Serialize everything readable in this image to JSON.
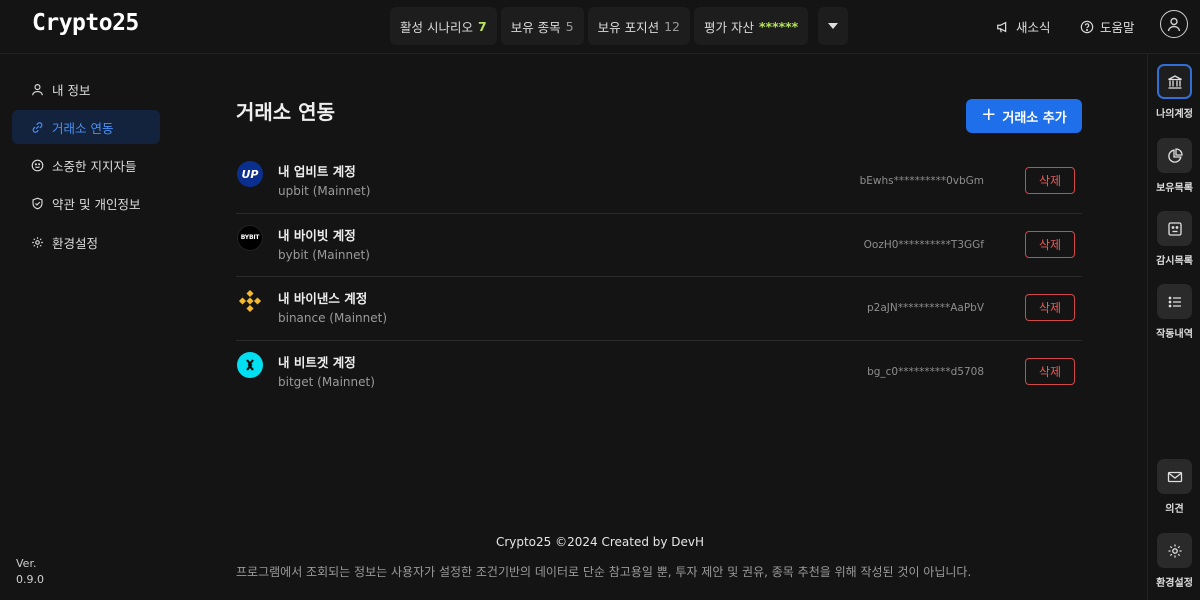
{
  "header": {
    "logo": "Crypto25",
    "stats": [
      {
        "label": "활성 시나리오",
        "value": "7",
        "color": "#b6e35b"
      },
      {
        "label": "보유 종목",
        "value": "5",
        "color": "#9a9a9a"
      },
      {
        "label": "보유 포지션",
        "value": "12",
        "color": "#9a9a9a"
      },
      {
        "label": "평가 자산",
        "value": "******",
        "color": "#b6e35b"
      }
    ],
    "news_label": "새소식",
    "help_label": "도움말"
  },
  "sidebar": {
    "items": [
      {
        "label": "내 정보",
        "icon": "user-icon"
      },
      {
        "label": "거래소 연동",
        "icon": "link-icon",
        "active": true
      },
      {
        "label": "소중한 지지자들",
        "icon": "smile-icon"
      },
      {
        "label": "약관 및 개인정보",
        "icon": "shield-icon"
      },
      {
        "label": "환경설정",
        "icon": "gear-icon"
      }
    ],
    "version_label": "Ver.",
    "version": "0.9.0"
  },
  "main": {
    "title": "거래소 연동",
    "add_button": "거래소 추가",
    "accounts": [
      {
        "name": "내 업비트 계정",
        "network": "upbit (Mainnet)",
        "key": "bEwhs**********0vbGm",
        "delete": "삭제",
        "logo": "upbit-logo",
        "logo_text": "UP",
        "logo_color": "#0b2f8f"
      },
      {
        "name": "내 바이빗 계정",
        "network": "bybit (Mainnet)",
        "key": "OozH0**********T3GGf",
        "delete": "삭제",
        "logo": "bybit-logo",
        "logo_text": "BYBIT",
        "logo_color": "#000000"
      },
      {
        "name": "내 바이낸스 계정",
        "network": "binance (Mainnet)",
        "key": "p2aJN**********AaPbV",
        "delete": "삭제",
        "logo": "binance-logo",
        "logo_color": "#f3ba2f"
      },
      {
        "name": "내 비트겟 계정",
        "network": "bitget (Mainnet)",
        "key": "bg_c0**********d5708",
        "delete": "삭제",
        "logo": "bitget-logo",
        "logo_color": "#00e0f0"
      }
    ]
  },
  "footer": {
    "title": "Crypto25 ©2024 Created by DevH",
    "note": "프로그램에서 조회되는 정보는 사용자가 설정한 조건기반의 데이터로 단순 참고용일 뿐, 투자 제안 및 권유, 종목 추천을 위해 작성된 것이 아닙니다."
  },
  "rail": {
    "items": [
      {
        "label": "나의계정",
        "icon": "bank-icon",
        "active": true
      },
      {
        "label": "보유목록",
        "icon": "pie-chart-icon"
      },
      {
        "label": "감시목록",
        "icon": "monitor-face-icon"
      },
      {
        "label": "작동내역",
        "icon": "list-icon"
      },
      {
        "label": "의견",
        "icon": "mail-icon"
      },
      {
        "label": "환경설정",
        "icon": "gear-icon"
      }
    ]
  },
  "colors": {
    "accent": "#1f6feb",
    "danger": "#d24848",
    "positive": "#b6e35b"
  }
}
